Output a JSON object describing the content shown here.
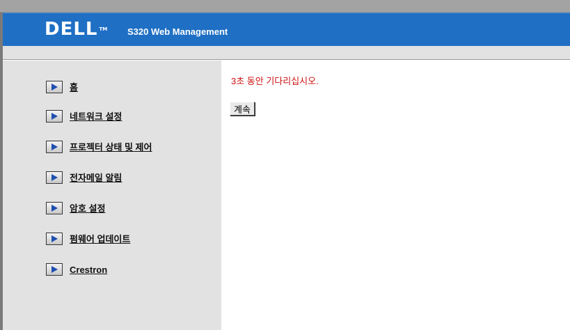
{
  "header": {
    "logo_text": "DELL",
    "trademark": "TM",
    "title": "S320 Web Management",
    "background_color": "#1f6fc4"
  },
  "sidebar": {
    "items": [
      {
        "label": "홈",
        "icon": "arrow-right-icon"
      },
      {
        "label": "네트워크 설정",
        "icon": "arrow-right-icon"
      },
      {
        "label": "프로젝터 상태 및 제어",
        "icon": "arrow-right-icon"
      },
      {
        "label": "전자메일 알림",
        "icon": "arrow-right-icon"
      },
      {
        "label": "암호 설정",
        "icon": "arrow-right-icon"
      },
      {
        "label": "펌웨어 업데이트",
        "icon": "arrow-right-icon"
      },
      {
        "label": "Crestron",
        "icon": "arrow-right-icon"
      }
    ]
  },
  "main": {
    "message": "3초 동안 기다리십시오.",
    "message_color": "#cc1111",
    "continue_button_label": "계속"
  }
}
